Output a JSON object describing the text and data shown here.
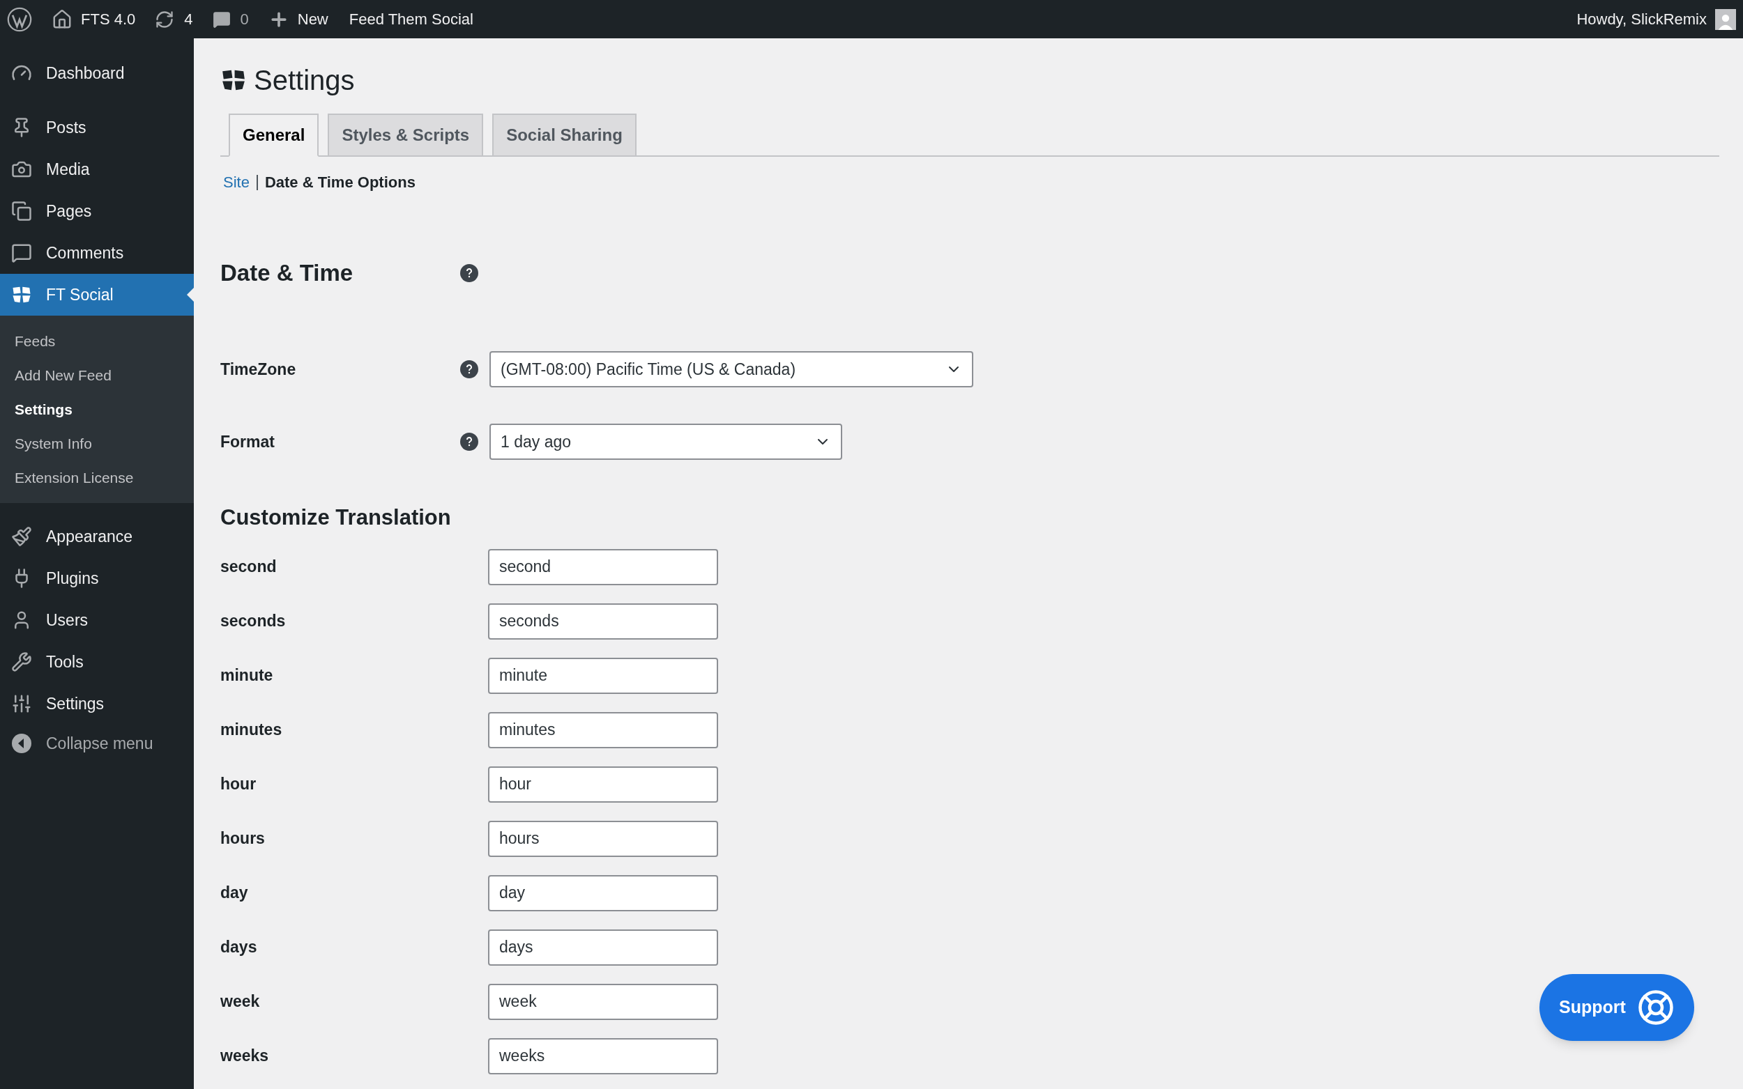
{
  "admin_bar": {
    "items": [
      {
        "kind": "logo"
      },
      {
        "kind": "home",
        "label": "FTS 4.0"
      },
      {
        "kind": "updates",
        "label": "4"
      },
      {
        "kind": "comments",
        "label": "0"
      },
      {
        "kind": "new",
        "label": "New"
      },
      {
        "kind": "text",
        "label": "Feed Them Social"
      }
    ],
    "account": "Howdy, SlickRemix"
  },
  "sidebar": {
    "items": [
      {
        "kind": "dashboard",
        "label": "Dashboard",
        "selected": false
      },
      {
        "kind": "posts",
        "label": "Posts",
        "selected": false
      },
      {
        "kind": "media",
        "label": "Media",
        "selected": false
      },
      {
        "kind": "pages",
        "label": "Pages",
        "selected": false
      },
      {
        "kind": "comments",
        "label": "Comments",
        "selected": false
      },
      {
        "kind": "fts",
        "label": "FT Social",
        "selected": true,
        "children": [
          {
            "label": "Feeds",
            "selected": false
          },
          {
            "label": "Add New Feed",
            "selected": false
          },
          {
            "label": "Settings",
            "selected": true
          },
          {
            "label": "System Info",
            "selected": false
          },
          {
            "label": "Extension License",
            "selected": false
          }
        ]
      },
      {
        "kind": "appearance",
        "label": "Appearance",
        "selected": false
      },
      {
        "kind": "plugins",
        "label": "Plugins",
        "selected": false
      },
      {
        "kind": "users",
        "label": "Users",
        "selected": false
      },
      {
        "kind": "tools",
        "label": "Tools",
        "selected": false
      },
      {
        "kind": "settings",
        "label": "Settings",
        "selected": false
      }
    ],
    "collapse": "Collapse menu"
  },
  "page": {
    "title": "Settings",
    "tabs": [
      {
        "label": "General",
        "selected": true
      },
      {
        "label": "Styles & Scripts",
        "selected": false
      },
      {
        "label": "Social Sharing",
        "selected": false
      }
    ],
    "subnav": [
      {
        "label": "Site",
        "selected": false
      },
      {
        "label": "Date & Time Options",
        "selected": true
      }
    ],
    "section_title": "Date & Time",
    "fields": [
      {
        "label": "TimeZone",
        "kind": "select",
        "value": "(GMT-08:00) Pacific Time (US & Canada)"
      },
      {
        "label": "Format",
        "kind": "select",
        "value": "1 day ago"
      }
    ],
    "translation_title": "Customize Translation",
    "translations": [
      {
        "label": "second",
        "value": "second"
      },
      {
        "label": "seconds",
        "value": "seconds"
      },
      {
        "label": "minute",
        "value": "minute"
      },
      {
        "label": "minutes",
        "value": "minutes"
      },
      {
        "label": "hour",
        "value": "hour"
      },
      {
        "label": "hours",
        "value": "hours"
      },
      {
        "label": "day",
        "value": "day"
      },
      {
        "label": "days",
        "value": "days"
      },
      {
        "label": "week",
        "value": "week"
      },
      {
        "label": "weeks",
        "value": "weeks"
      }
    ],
    "support_button": "Support"
  }
}
